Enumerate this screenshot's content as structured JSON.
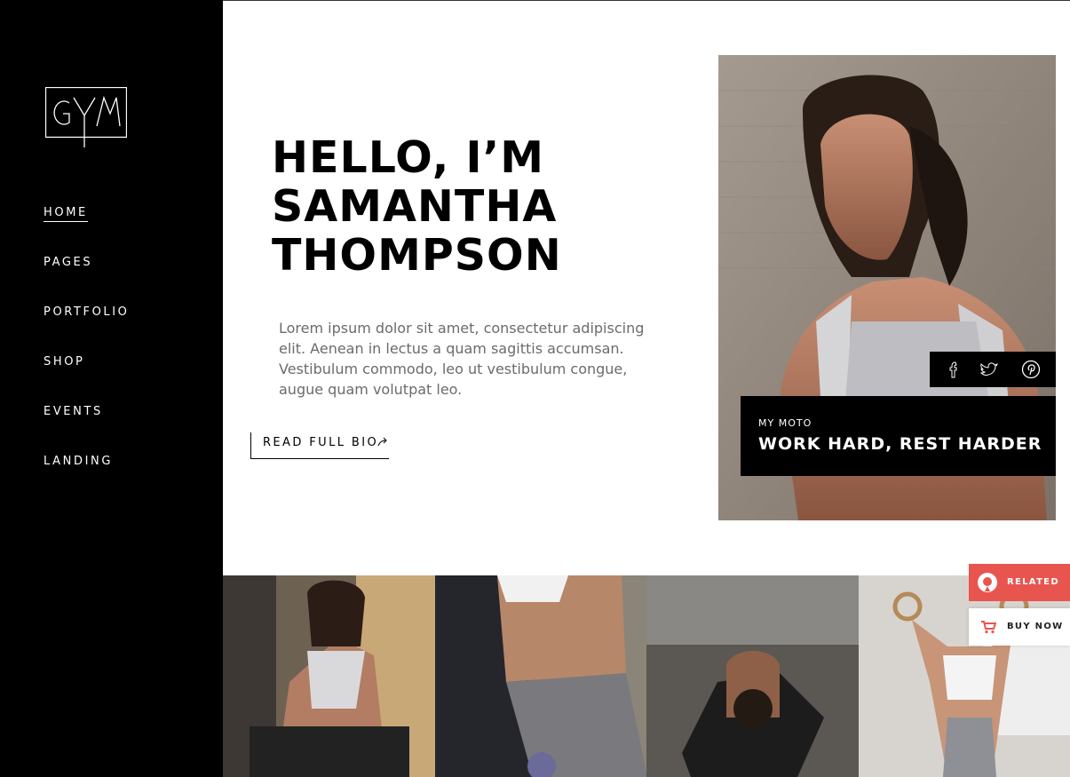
{
  "sidebar": {
    "logo_text": "GYM",
    "nav": [
      {
        "label": "HOME",
        "active": true
      },
      {
        "label": "PAGES",
        "active": false
      },
      {
        "label": "PORTFOLIO",
        "active": false
      },
      {
        "label": "SHOP",
        "active": false
      },
      {
        "label": "EVENTS",
        "active": false
      },
      {
        "label": "LANDING",
        "active": false
      }
    ]
  },
  "hero": {
    "title_lines": [
      "HELLO, I’M",
      "SAMANTHA",
      "THOMPSON"
    ],
    "text": "Lorem ipsum dolor sit amet, consectetur adipiscing elit. Aenean in lectus a quam sagittis accumsan. Vestibulum commodo, leo ut vestibulum congue, augue quam volutpat leo.",
    "bio_button": "READ FULL BIO"
  },
  "portrait": {
    "social_icons": [
      "facebook-icon",
      "twitter-icon",
      "pinterest-icon"
    ],
    "moto_label": "MY MOTO",
    "moto_text": "WORK HARD, REST HARDER"
  },
  "gallery": {
    "tiles": [
      "gym-rower-photo",
      "abs-floor-photo",
      "crunch-mat-photo",
      "gym-rings-photo"
    ]
  },
  "floating": {
    "related_label": "RELATED",
    "buy_label": "BUY NOW"
  },
  "colors": {
    "sidebar_bg": "#000000",
    "accent": "#e8554f"
  }
}
